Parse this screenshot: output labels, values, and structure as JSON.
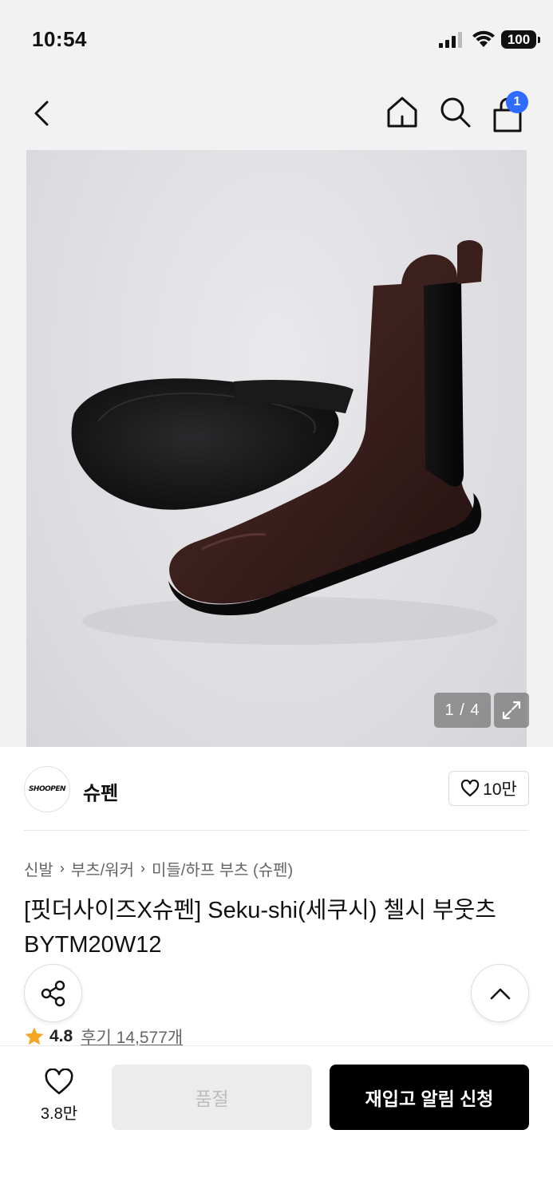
{
  "status_bar": {
    "time": "10:54",
    "battery": "100"
  },
  "nav": {
    "cart_badge": "1"
  },
  "gallery": {
    "pager": "1 / 4"
  },
  "brand": {
    "logo_text": "SHOOPEN",
    "name": "슈펜",
    "likes": "10만"
  },
  "breadcrumb": [
    "신발",
    "부츠/워커",
    "미들/하프 부츠 (슈펜)"
  ],
  "product": {
    "title": "[핏더사이즈X슈펜] Seku-shi(세쿠시) 첼시 부웃츠 BYTM20W12",
    "rating": "4.8",
    "reviews": "후기 14,577개"
  },
  "bottom_bar": {
    "wish_count": "3.8만",
    "soldout_label": "품절",
    "restock_label": "재입고 알림 신청"
  },
  "colors": {
    "accent_blue": "#2e6bff",
    "star": "#f5a623",
    "primary_button": "#000000",
    "disabled_button": "#ececec"
  }
}
